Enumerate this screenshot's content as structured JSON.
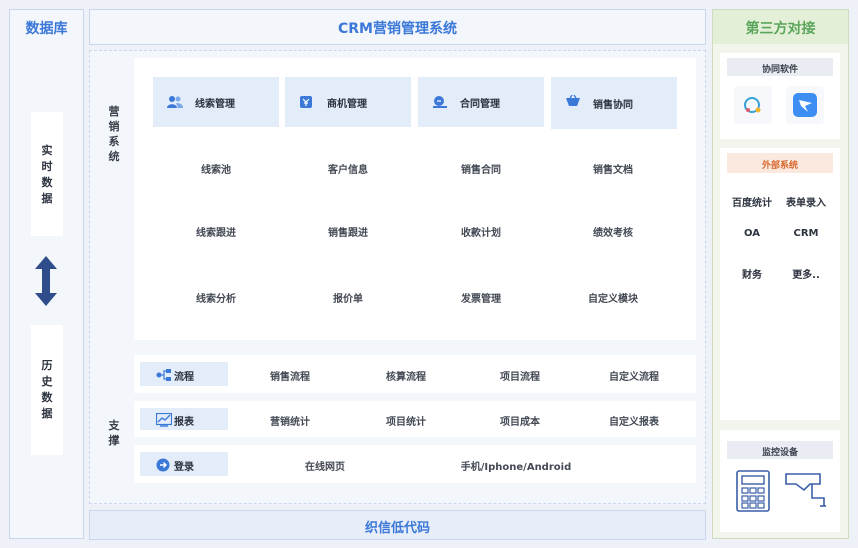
{
  "database": {
    "title": "数据库",
    "realtime_label": "实时数据",
    "history_label": "历史数据",
    "arrow_icon": "double-arrow-icon"
  },
  "main": {
    "title": "CRM营销管理系统",
    "marketing_side_label": "营销系统",
    "support_side_label": "支撑",
    "modules": [
      {
        "label": "线索管理",
        "icon": "users-icon",
        "items": [
          "线索池",
          "线索跟进",
          "线索分析"
        ]
      },
      {
        "label": "商机管理",
        "icon": "business-icon",
        "items": [
          "客户信息",
          "销售跟进",
          "报价单"
        ]
      },
      {
        "label": "合同管理",
        "icon": "contract-icon",
        "items": [
          "销售合同",
          "收款计划",
          "发票管理"
        ]
      },
      {
        "label": "销售协同",
        "icon": "cart-icon",
        "items": [
          "销售文档",
          "绩效考核",
          "自定义模块"
        ]
      }
    ],
    "support_rows": [
      {
        "label": "流程",
        "icon": "flow-icon",
        "items": [
          "销售流程",
          "核算流程",
          "项目流程",
          "自定义流程"
        ]
      },
      {
        "label": "报表",
        "icon": "chart-icon",
        "items": [
          "营销统计",
          "项目统计",
          "项目成本",
          "自定义报表"
        ]
      },
      {
        "label": "登录",
        "icon": "login-icon",
        "items": [
          "在线网页",
          "手机/Iphone/Android"
        ]
      }
    ],
    "footer": "织信低代码"
  },
  "third_party": {
    "title": "第三方对接",
    "collab": {
      "title": "协同软件",
      "icons": [
        "chat-app-icon",
        "dingtalk-icon"
      ]
    },
    "external": {
      "title": "外部系统",
      "items": [
        "百度统计",
        "表单录入",
        "OA",
        "CRM",
        "财务",
        "更多.."
      ]
    },
    "monitor": {
      "title": "监控设备",
      "icons": [
        "calculator-device-icon",
        "camera-device-icon"
      ]
    }
  },
  "colors": {
    "accent": "#3b78d8",
    "panel_border": "#c9d7ec",
    "green_title": "#5aa55a",
    "orange_title": "#d8692f"
  }
}
